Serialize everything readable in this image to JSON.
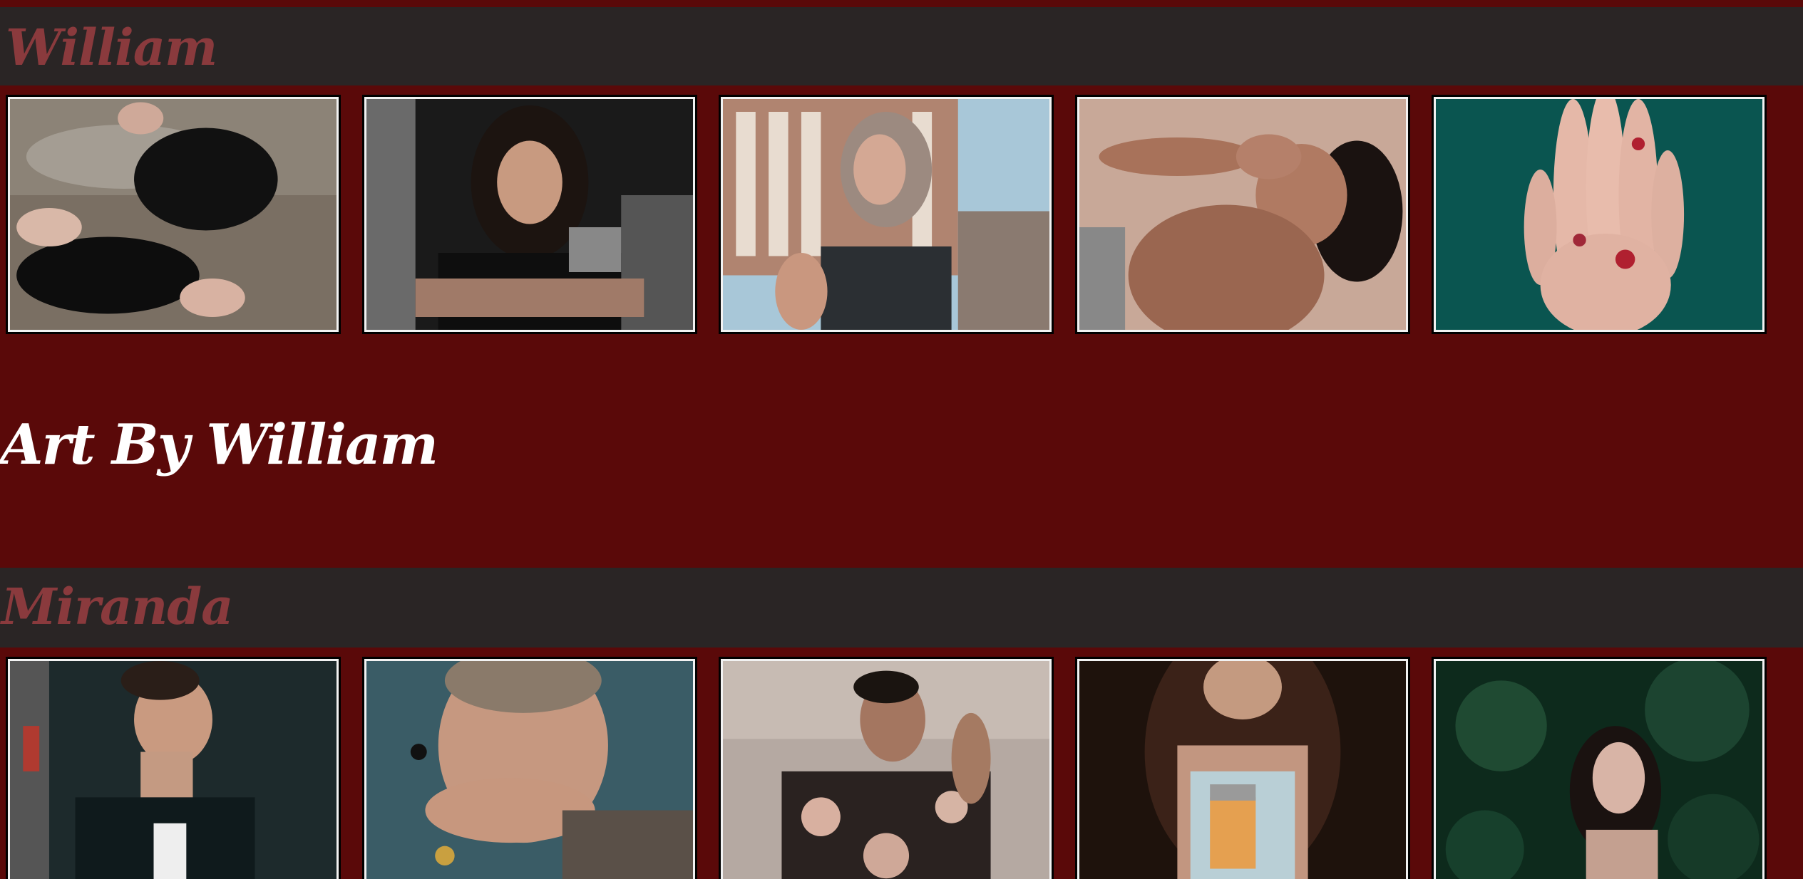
{
  "colors": {
    "page_background": "#5a0909",
    "artist_bar_background": "#2a2525",
    "artist_name_color": "#8a3a3d",
    "heading_color": "#ffffff",
    "tile_border": "#f2f2f2"
  },
  "artists": [
    {
      "name": "William",
      "photos": [
        {
          "subject": "two tattooed women lying on rocks"
        },
        {
          "subject": "long-haired tattooed man with crossed arms"
        },
        {
          "subject": "woman in lace-up tank top with city background"
        },
        {
          "subject": "woman with hand tattoo resting on head"
        },
        {
          "subject": "hand with floral tattoos on teal background"
        }
      ]
    },
    {
      "name": "Miranda",
      "photos": [
        {
          "subject": "man with neck tattoo in dark shirt"
        },
        {
          "subject": "man with earring covering mouth with tattooed arm"
        },
        {
          "subject": "man in floral shirt with tattooed arm"
        },
        {
          "subject": "curly-haired woman holding jar drink"
        },
        {
          "subject": "woman looking up among green leaves"
        }
      ]
    }
  ],
  "sections": {
    "art_heading": "Art By William"
  }
}
